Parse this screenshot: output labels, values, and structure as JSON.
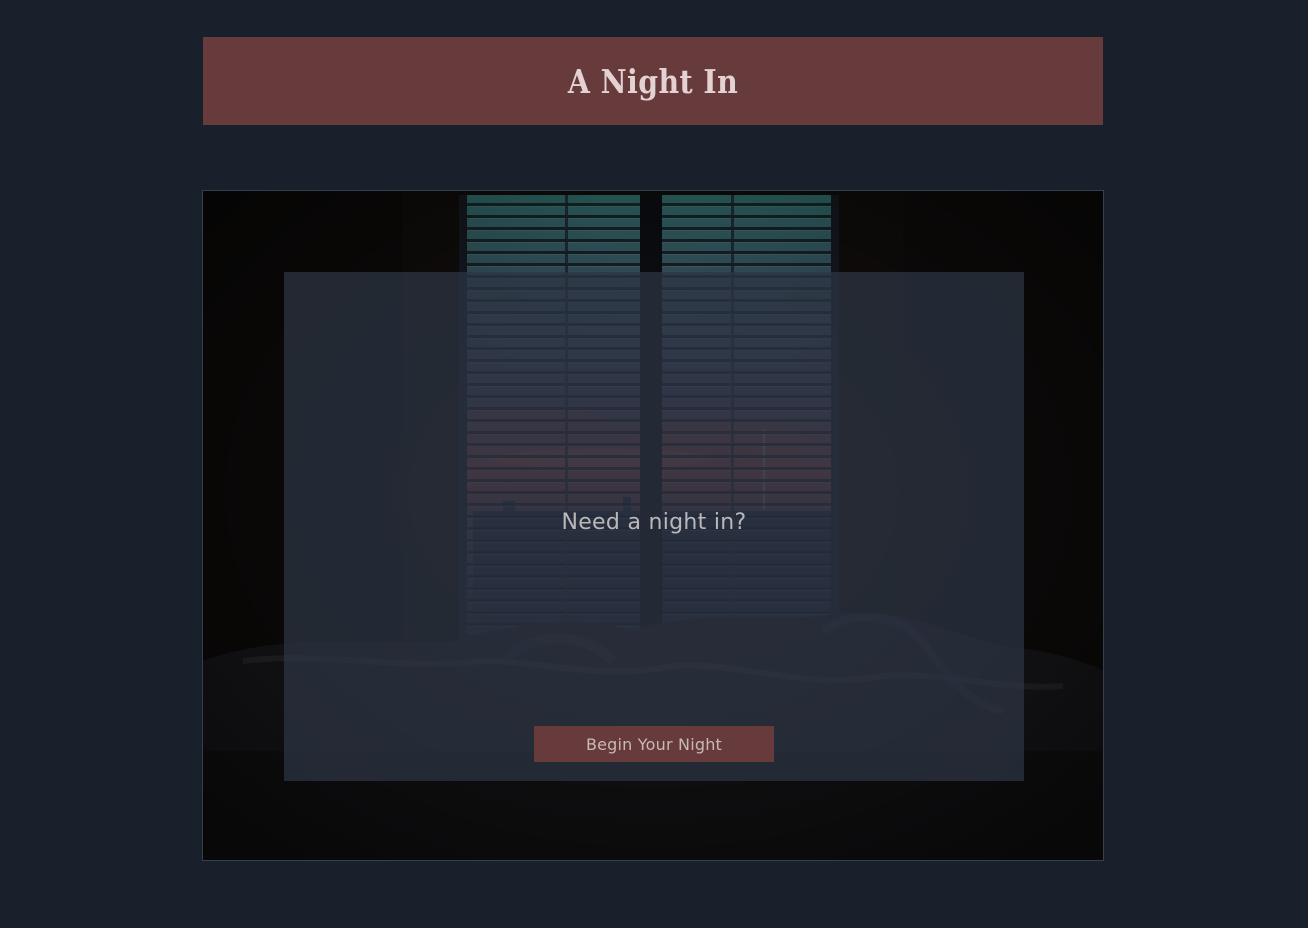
{
  "header": {
    "title": "A Night In"
  },
  "hero": {
    "image": "bedroom-window-blinds-sunset-photo",
    "tagline": "Need a night in?",
    "cta_label": "Begin Your Night"
  },
  "colors": {
    "page_background": "#17202b",
    "accent": "#673b3b",
    "overlay": "#2c3444"
  }
}
